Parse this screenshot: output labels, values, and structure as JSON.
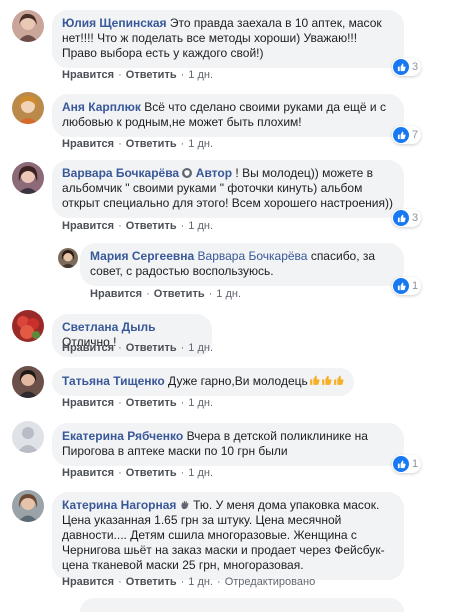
{
  "actions": {
    "like": "Нравится",
    "reply": "Ответить",
    "separator": "·",
    "edited": "Отредактировано"
  },
  "comments": [
    {
      "author": "Юлия Щепинская",
      "text": "Это правда заехала в 10 аптек, масок нет!!!! Что ж поделать все методы хороши) Уважаю!!! Право выбора есть у каждого свой!)",
      "time": "1 дн.",
      "reactions": "3"
    },
    {
      "author": "Аня Карплюк",
      "text": "Всё что сделано своими руками да ещё и с любовью к родным,не может быть плохим!",
      "time": "1 дн.",
      "reactions": "7"
    },
    {
      "author": "Варвара Бочкарёва",
      "author_suffix": "Автор",
      "text": "! Вы молодец)) можете в альбомчик \" своими руками \" фоточки кинуть) альбом открыт специально для этого! Всем хорошего настроения))",
      "time": "1 дн.",
      "reactions": "3"
    },
    {
      "author": "Мария Сергеевна",
      "mention": "Варвара Бочкарёва",
      "text": "спасибо, за совет, с радостью воспользуюсь.",
      "time": "1 дн.",
      "reactions": "1"
    },
    {
      "author": "Светлана Дыль",
      "text": "Отлично !",
      "time": "1 дн."
    },
    {
      "author": "Татьяна Тищенко",
      "text": "Дуже гарно,Ви молодець",
      "time": "1 дн."
    },
    {
      "author": "Екатерина Рябченко",
      "text": "Вчера в детской поликлинике на Пирогова в аптеке маски по 10 грн были",
      "time": "1 дн.",
      "reactions": "1"
    },
    {
      "author": "Катерина Нагорная",
      "text": "Тю. У меня дома упаковка масок. Цена указанная 1.65 грн за штуку. Цена месячной давности.... Детям сшила многоразовые. Женщина с Чернигова шьёт на заказ маски и продает через Фейсбук-цена тканевой маски 25 грн, многоразовая.",
      "time": "1 дн."
    }
  ],
  "colors": {
    "link": "#385898",
    "bubble": "#f2f3f5",
    "like_blue": "#1877f2",
    "meta": "#606770"
  }
}
